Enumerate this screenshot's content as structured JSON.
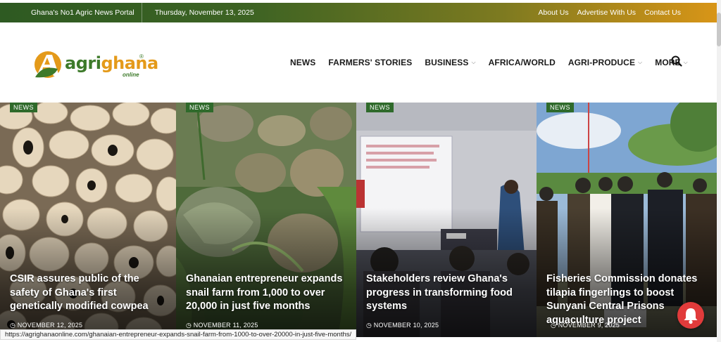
{
  "topbar": {
    "tagline": "Ghana's No1 Agric News Portal",
    "date": "Thursday, November 13, 2025",
    "links": [
      "About Us",
      "Advertise With Us",
      "Contact Us"
    ]
  },
  "logo": {
    "word_a": "agri",
    "word_b": "ghana",
    "sub": "online",
    "reg": "®"
  },
  "nav": {
    "items": [
      {
        "label": "NEWS",
        "dropdown": false
      },
      {
        "label": "FARMERS' STORIES",
        "dropdown": false
      },
      {
        "label": "BUSINESS",
        "dropdown": true
      },
      {
        "label": "AFRICA/WORLD",
        "dropdown": false
      },
      {
        "label": "AGRI-PRODUCE",
        "dropdown": true
      },
      {
        "label": "MORE",
        "dropdown": true
      }
    ],
    "search_icon": "search-icon"
  },
  "cards": [
    {
      "badge": "NEWS",
      "title": "CSIR assures public of the safety of Ghana's first genetically modified cowpea",
      "date": "NOVEMBER 12, 2025"
    },
    {
      "badge": "NEWS",
      "title": "Ghanaian entrepreneur expands snail farm from 1,000 to over 20,000 in just five months",
      "date": "NOVEMBER 11, 2025"
    },
    {
      "badge": "NEWS",
      "title": "Stakeholders review Ghana's progress in transforming food systems",
      "date": "NOVEMBER 10, 2025"
    },
    {
      "badge": "NEWS",
      "title": "Fisheries Commission donates tilapia fingerlings to boost Sunyani Central Prisons aquaculture project",
      "date": "NOVEMBER 9, 2025"
    }
  ],
  "status_url": "https://agrighanaonline.com/ghanaian-entrepreneur-expands-snail-farm-from-1000-to-over-20000-in-just-five-months/",
  "colors": {
    "brand_green": "#3d7a2a",
    "brand_orange": "#e49a1a",
    "badge_green": "#2f6a2b",
    "notify_red": "#e13b3b"
  }
}
